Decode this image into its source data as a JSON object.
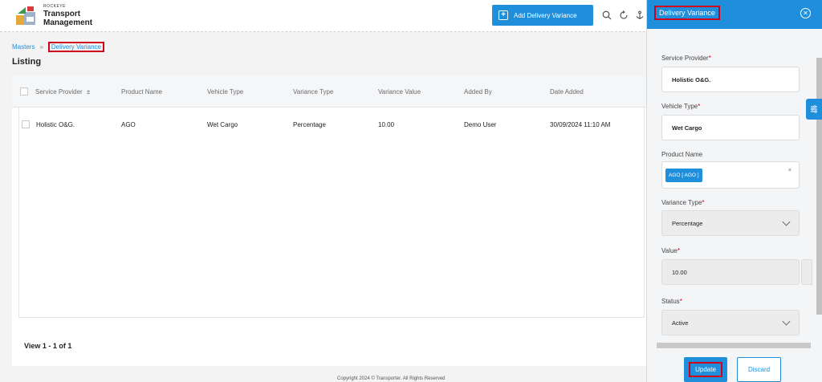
{
  "header": {
    "brand_small": "ROCKEYE",
    "brand_line1": "Transport",
    "brand_line2": "Management",
    "add_button_label": "Add Delivery Variance",
    "icons": [
      "search-icon",
      "refresh-icon",
      "anchor-icon"
    ]
  },
  "breadcrumb": {
    "root": "Masters",
    "separator": "»",
    "current": "Delivery Variance"
  },
  "page_title": "Listing",
  "table": {
    "columns": [
      "Service Provider",
      "Product Name",
      "Vehicle Type",
      "Variance Type",
      "Variance Value",
      "Added By",
      "Date Added"
    ],
    "sort_indicator": "±",
    "rows": [
      {
        "service_provider": "Holistic O&G.",
        "product_name": "AGO",
        "vehicle_type": "Wet Cargo",
        "variance_type": "Percentage",
        "variance_value": "10.00",
        "added_by": "Demo User",
        "date_added": "30/09/2024 11:10 AM"
      }
    ]
  },
  "pager": "View 1 - 1 of 1",
  "footer": "Copyright 2024 © Transporter. All Rights Reserved",
  "panel": {
    "title": "Delivery Variance",
    "fields": {
      "service_provider": {
        "label": "Service Provider",
        "value": "Holistic O&G."
      },
      "vehicle_type": {
        "label": "Vehicle Type",
        "value": "Wet Cargo"
      },
      "product_name": {
        "label": "Product Name",
        "chip": "AGO [ AGO ]",
        "clear": "×"
      },
      "variance_type": {
        "label": "Variance Type",
        "value": "Percentage"
      },
      "value": {
        "label": "Value",
        "value": "10.00",
        "suffix": "%"
      },
      "status": {
        "label": "Status",
        "value": "Active"
      }
    },
    "required_mark": "*",
    "update_label": "Update",
    "discard_label": "Discard"
  },
  "colors": {
    "accent": "#1f8fdc",
    "highlight": "#d0021b"
  }
}
